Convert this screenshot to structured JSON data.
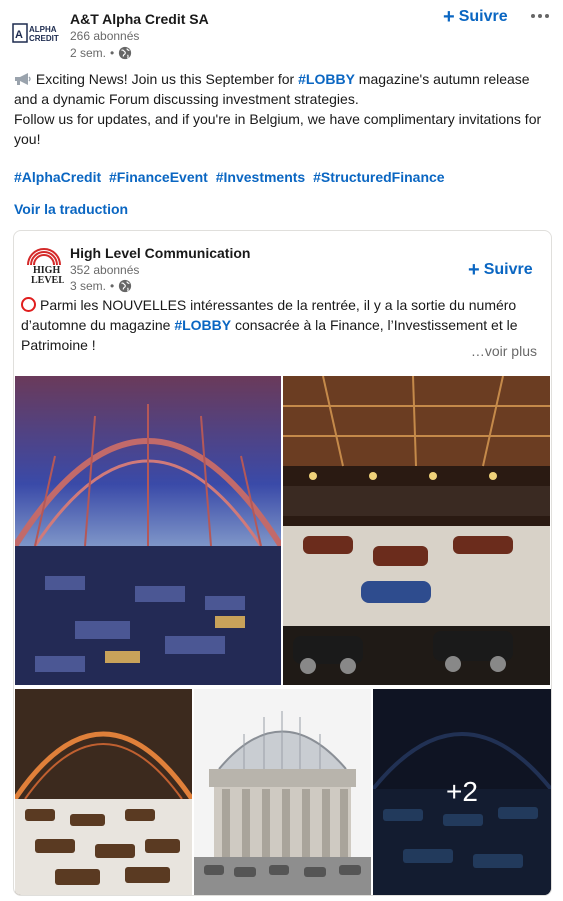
{
  "post": {
    "author": {
      "name": "A&T Alpha Credit SA",
      "followers": "266 abonnés",
      "time": "2 sem.",
      "logo_text": [
        "ALPHA",
        "CREDIT"
      ]
    },
    "follow_label": "Suivre",
    "text": {
      "line1_prefix": "Exciting News! Join us this September for ",
      "line1_tag": "#LOBBY",
      "line1_suffix": " magazine's autumn release and a dynamic Forum discussing investment strategies.",
      "line2": "Follow us for updates, and if you're in Belgium, we have complimentary invitations for you!"
    },
    "hashtags": [
      "#AlphaCredit",
      "#FinanceEvent",
      "#Investments",
      "#StructuredFinance"
    ],
    "translate_label": "Voir la traduction"
  },
  "reshare": {
    "author": {
      "name": "High Level Communication",
      "followers": "352 abonnés",
      "time": "3 sem."
    },
    "follow_label": "Suivre",
    "text_prefix": "Parmi les NOUVELLES intéressantes de la rentrée, il y a la sortie du numéro d’automne du magazine ",
    "text_tag": "#LOBBY",
    "text_suffix": " consacrée à la Finance, l’Investissement et le Patrimoine !",
    "see_more": "…voir plus",
    "more_images_label": "+2"
  },
  "colors": {
    "link_blue": "#0a66c2",
    "muted": "#666666",
    "border": "#e0dfdc"
  }
}
